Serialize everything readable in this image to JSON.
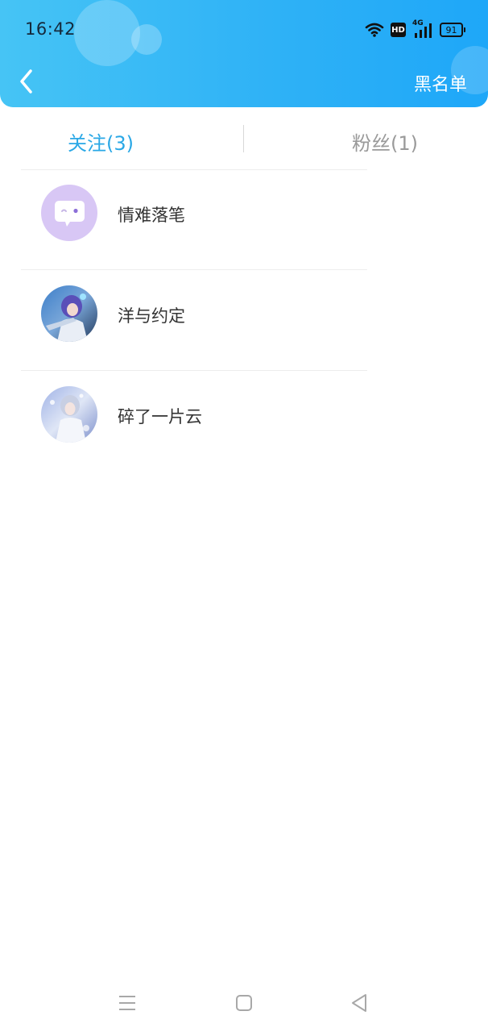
{
  "status_bar": {
    "time": "16:42",
    "icons": [
      "wifi-icon",
      "hd-icon",
      "signal-4g-icon",
      "battery-icon"
    ],
    "hd_label": "HD",
    "network_label": "4G",
    "battery_level": "91"
  },
  "header": {
    "back_icon": "chevron-left-icon",
    "action_label": "黑名单"
  },
  "tabs": [
    {
      "label": "关注(3)",
      "active": true
    },
    {
      "label": "粉丝(1)",
      "active": false
    }
  ],
  "users": [
    {
      "name": "情难落笔",
      "avatar": "chat-bubble-avatar"
    },
    {
      "name": "洋与约定",
      "avatar": "anime-character-avatar"
    },
    {
      "name": "碎了一片云",
      "avatar": "anime-character-avatar"
    }
  ],
  "nav_bar": {
    "icons": [
      "menu-icon",
      "home-square-icon",
      "back-triangle-icon"
    ]
  },
  "colors": {
    "header_gradient_start": "#46c4f5",
    "header_gradient_end": "#1ea7f8",
    "active_tab": "#2aa8e6",
    "inactive_tab": "#9a9a9a",
    "avatar_purple": "#d8c7f5"
  }
}
